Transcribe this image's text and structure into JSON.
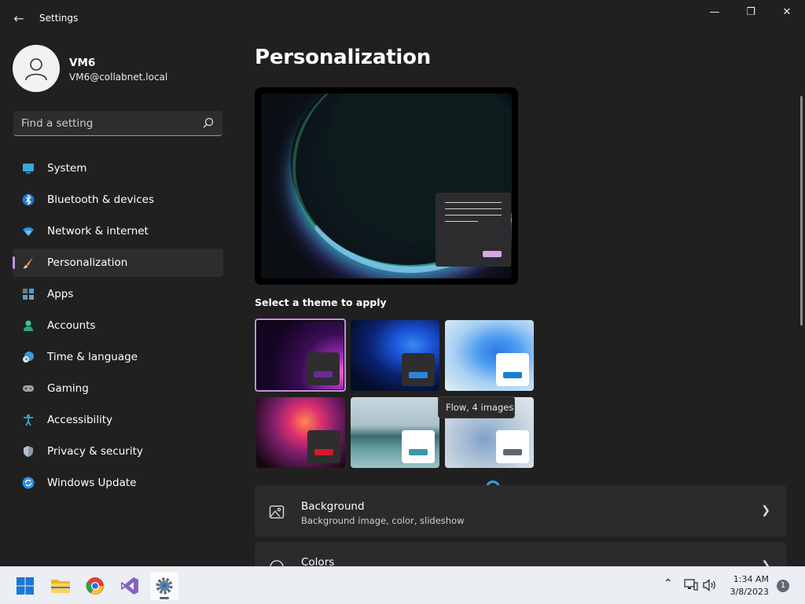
{
  "window": {
    "title": "Settings",
    "minimize": "—",
    "maximize": "❐",
    "close": "✕"
  },
  "user": {
    "name": "VM6",
    "email": "VM6@collabnet.local"
  },
  "search": {
    "placeholder": "Find a setting"
  },
  "sidebar": {
    "items": [
      {
        "label": "System",
        "icon": "monitor-icon"
      },
      {
        "label": "Bluetooth & devices",
        "icon": "bluetooth-icon"
      },
      {
        "label": "Network & internet",
        "icon": "wifi-icon"
      },
      {
        "label": "Personalization",
        "icon": "brush-icon",
        "active": true
      },
      {
        "label": "Apps",
        "icon": "apps-icon"
      },
      {
        "label": "Accounts",
        "icon": "person-icon"
      },
      {
        "label": "Time & language",
        "icon": "globe-clock-icon"
      },
      {
        "label": "Gaming",
        "icon": "gamepad-icon"
      },
      {
        "label": "Accessibility",
        "icon": "accessibility-icon"
      },
      {
        "label": "Privacy & security",
        "icon": "shield-icon"
      },
      {
        "label": "Windows Update",
        "icon": "update-icon"
      }
    ]
  },
  "main": {
    "title": "Personalization",
    "themes_label": "Select a theme to apply",
    "tooltip": "Flow, 4 images",
    "cards": [
      {
        "title": "Background",
        "subtitle": "Background image, color, slideshow",
        "icon": "image-icon"
      },
      {
        "title": "Colors",
        "subtitle": "",
        "icon": "palette-icon"
      }
    ]
  },
  "colors": {
    "accent": "#c98de0",
    "background": "#202020",
    "card": "#2b2b2b"
  },
  "taskbar": {
    "apps": [
      "start-icon",
      "file-explorer-icon",
      "chrome-icon",
      "visual-studio-icon",
      "settings-icon"
    ],
    "time": "1:34 AM",
    "date": "3/8/2023",
    "notifications": "1"
  }
}
